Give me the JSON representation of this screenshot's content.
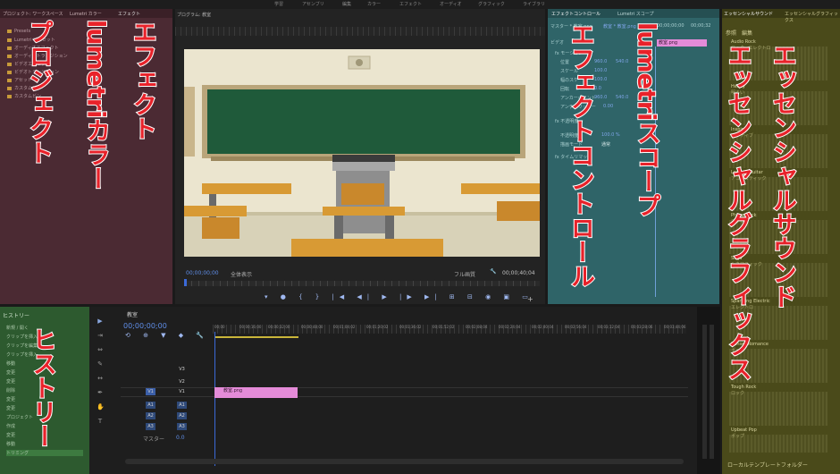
{
  "workspace_tabs": [
    "学習",
    "アセンブリ",
    "編集",
    "カラー",
    "エフェクト",
    "オーディオ",
    "グラフィック",
    "ライブラリ"
  ],
  "project_panel": {
    "tabs": [
      "プロジェクト: ワークスペース",
      "Lumetri カラー",
      "エフェクト"
    ],
    "items": [
      "Presets",
      "Lumetri プリセット",
      "オーディオエフェクト",
      "オーディオトランジション",
      "ビデオエフェクト",
      "ビデオトランジション",
      "アセット",
      "カスタムビン",
      "カスタムビン"
    ]
  },
  "history_panel": {
    "title": "ヒストリー",
    "items": [
      "新規 / 開く",
      "クリップを挿入",
      "クリップを編集",
      "クリップを挿入",
      "移動",
      "変更",
      "変更",
      "削除",
      "変更",
      "変更",
      "プロジェクト",
      "作成",
      "変更",
      "移動",
      "トリミング"
    ]
  },
  "program_monitor": {
    "tab": "プログラム: 教室",
    "timecode_left": "00;00;00;00",
    "fit": "全体表示",
    "quality": "フル画質",
    "timecode_right": "00;00;40;04"
  },
  "effect_controls": {
    "tabs": [
      "エフェクトコントロール",
      "Lumetri スコープ"
    ],
    "source": "マスター * 教室.png",
    "clip": "教室 * 教室.png",
    "clip_label": "教室.png",
    "rows": [
      "ビデオ",
      "fx モーション",
      "位置",
      "スケール",
      "幅のスケール",
      "回転",
      "アンカーポイント",
      "アンチフリッカー",
      "fx 不透明度",
      "不透明度",
      "描画モード",
      "fx タイムリマップ"
    ],
    "values": [
      "960.0",
      "540.0",
      "100.0",
      "100.0",
      "0.0",
      "960.0",
      "540.0",
      "0.00",
      "100.0 %",
      "通常"
    ],
    "timecode": "00;00;00;00",
    "end_timecode": "00;00;32"
  },
  "essential_panel": {
    "tabs": [
      "エッセンシャルサウンド",
      "エッセンシャルグラフィックス"
    ],
    "subtabs": [
      "参照",
      "編集"
    ],
    "items": [
      "Audio Rock",
      "Heavy",
      "Inspire",
      "Lowkey Guitar",
      "Phase Rock",
      "Saga",
      "Sparkling Electric",
      "Sunset Romance",
      "Tough Rock",
      "Upbeat Pop"
    ],
    "descriptions": [
      "ロック、エレクトロ",
      "明るい",
      "ポジティブ",
      "アコースティック",
      "ロック",
      "シネマティック",
      "エレクトロ",
      "ポップ",
      "ロック",
      "ポップ"
    ],
    "footer": "ローカルテンプレートフォルダー"
  },
  "timeline": {
    "tab": "教室",
    "timecode": "00;00;00;00",
    "ruler": [
      "00;00",
      "00;00;16;00",
      "00;00;32;00",
      "00;00;48;00",
      "00;01;04;02",
      "00;01;20;02",
      "00;01;36;02",
      "00;01;52;02",
      "00;02;08;04",
      "00;02;24;04",
      "00;02;40;04",
      "00;02;56;04",
      "00;03;12;04",
      "00;03;28;06",
      "00;03;44;06"
    ],
    "video_tracks": [
      "V3",
      "V2",
      "V1"
    ],
    "audio_tracks": [
      "A1",
      "A2",
      "A3"
    ],
    "master": "マスター",
    "master_value": "0.0",
    "clip_label": "教室.png"
  },
  "overlay_labels": {
    "project": "プロジェクト",
    "lumetri_color": "lumetriカラー",
    "effects": "エフェクト",
    "history": "ヒストリー",
    "effect_controls": "エフェクトコントロール",
    "lumetri_scope": "lumetriスコープ",
    "essential_sound": "エッセンシャルサウンド",
    "essential_graphics": "エッセンシャルグラフィックス"
  },
  "colors": {
    "project_panel": "#4b2a33",
    "history_panel": "#2d5a2f",
    "effect_panel": "#2f6468",
    "essential_panel": "#4a4a1a",
    "overlay_text": "#e8222a",
    "clip": "#e48bd8",
    "accent": "#3b6ad8"
  }
}
